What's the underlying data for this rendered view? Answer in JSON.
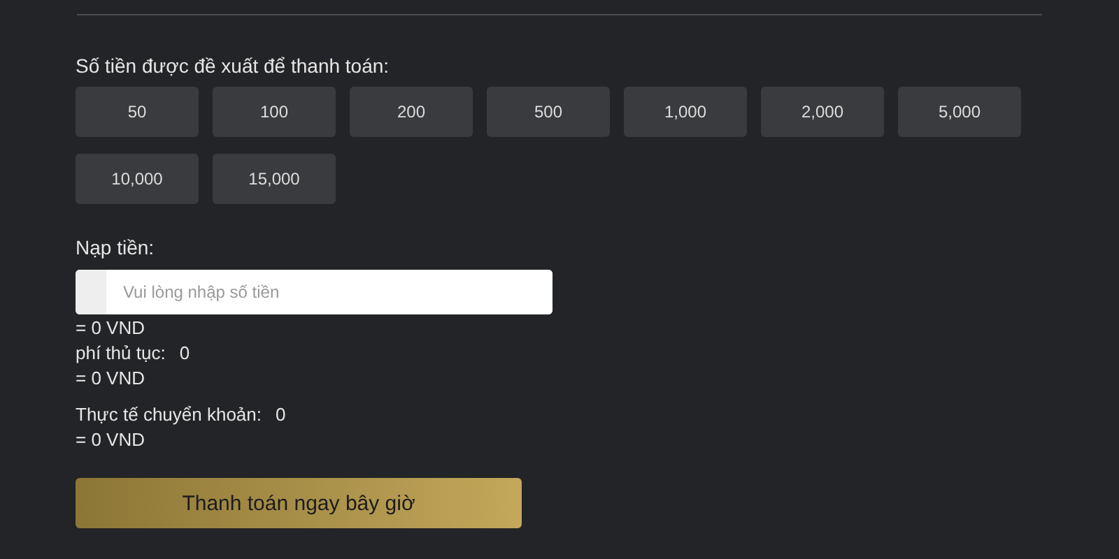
{
  "suggested_amounts": {
    "label": "Số tiền được đề xuất để thanh toán:",
    "options": [
      "50",
      "100",
      "200",
      "500",
      "1,000",
      "2,000",
      "5,000",
      "10,000",
      "15,000"
    ]
  },
  "deposit": {
    "label": "Nạp tiền:",
    "placeholder": "Vui lòng nhập số tiền",
    "converted": "= 0 VND"
  },
  "fee": {
    "label": "phí thủ tục:",
    "value": "0",
    "converted": "= 0 VND"
  },
  "actual_transfer": {
    "label": "Thực tế chuyển khoản:",
    "value": "0",
    "converted": "= 0 VND"
  },
  "submit_button": "Thanh toán ngay bây giờ"
}
